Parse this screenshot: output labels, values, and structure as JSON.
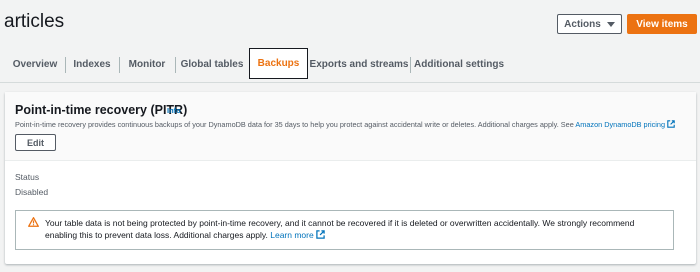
{
  "header": {
    "title": "articles",
    "actions_label": "Actions",
    "view_items_label": "View items"
  },
  "tabs": [
    {
      "label": "Overview",
      "active": false
    },
    {
      "label": "Indexes",
      "active": false
    },
    {
      "label": "Monitor",
      "active": false
    },
    {
      "label": "Global tables",
      "active": false
    },
    {
      "label": "Backups",
      "active": true
    },
    {
      "label": "Exports and streams",
      "active": false
    },
    {
      "label": "Additional settings",
      "active": false
    }
  ],
  "pitr": {
    "title": "Point-in-time recovery (PITR)",
    "info_label": "Info",
    "description": "Point-in-time recovery provides continuous backups of your DynamoDB data for 35 days to help you protect against accidental write or deletes. Additional charges apply. See ",
    "pricing_link": "Amazon DynamoDB pricing",
    "edit_label": "Edit",
    "status_label": "Status",
    "status_value": "Disabled"
  },
  "alert": {
    "text": "Your table data is not being protected by point-in-time recovery, and it cannot be recovered if it is deleted or overwritten accidentally. We strongly recommend enabling this to prevent data loss. Additional charges apply. ",
    "learn_more": "Learn more"
  },
  "colors": {
    "accent": "#ec7211",
    "link": "#0073bb",
    "warning": "#ec7211",
    "background": "#f2f3f3"
  },
  "icons": {
    "actions_caret": "caret-down-icon",
    "external_link": "external-link-icon",
    "warning": "warning-icon"
  }
}
